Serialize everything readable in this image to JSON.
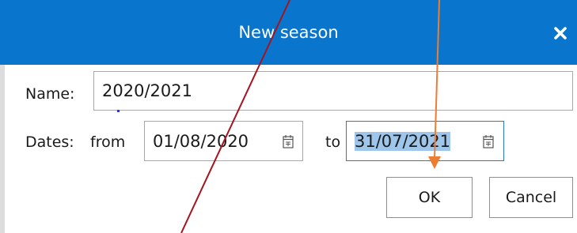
{
  "dialog": {
    "title": "New season",
    "close_icon": "close-icon"
  },
  "form": {
    "name_label": "Name:",
    "name_value": "2020/2021",
    "dates_label": "Dates:",
    "from_label": "from",
    "from_value": "01/08/2020",
    "to_label": "to",
    "to_value": "31/07/2021",
    "calendar_icon": "calendar-icon"
  },
  "buttons": {
    "ok_label": "OK",
    "cancel_label": "Cancel"
  },
  "colors": {
    "titlebar": "#0a75cc",
    "selection": "#9ec6ea",
    "annotation_red": "#a5141e",
    "annotation_orange": "#ed7d31"
  }
}
